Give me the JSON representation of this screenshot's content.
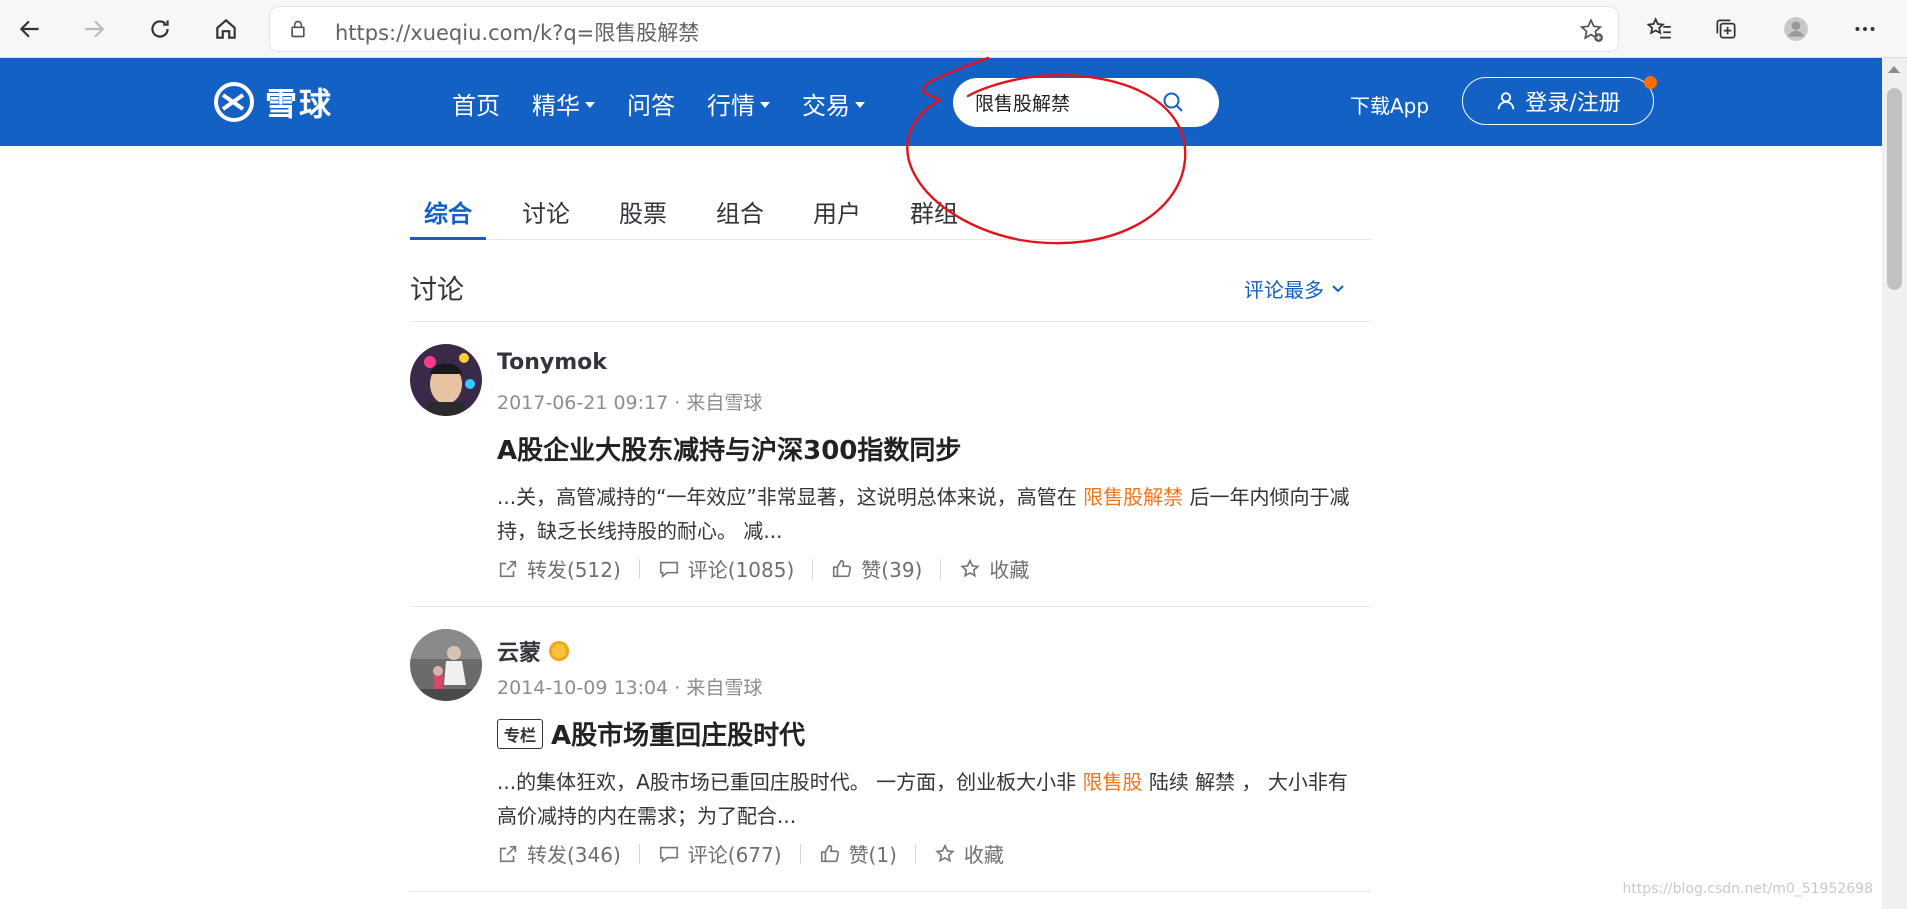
{
  "browser": {
    "url": "https://xueqiu.com/k?q=限售股解禁"
  },
  "site": {
    "logo_text": "雪球",
    "nav": [
      {
        "label": "首页",
        "has_menu": false
      },
      {
        "label": "精华",
        "has_menu": true
      },
      {
        "label": "问答",
        "has_menu": false
      },
      {
        "label": "行情",
        "has_menu": true
      },
      {
        "label": "交易",
        "has_menu": true
      }
    ],
    "search_value": "限售股解禁",
    "download_label": "下载App",
    "login_label": "登录/注册",
    "brand_color": "#1461c5",
    "highlight_color": "#f3751a"
  },
  "tabs": [
    "综合",
    "讨论",
    "股票",
    "组合",
    "用户",
    "群组"
  ],
  "active_tab": "综合",
  "section": {
    "title": "讨论",
    "sort_label": "评论最多"
  },
  "posts": [
    {
      "author": "Tonymok",
      "meta": "2017-06-21 09:17 · 来自雪球",
      "tag": "",
      "title": "A股企业大股东减持与沪深300指数同步",
      "excerpt_before": "...关，高管减持的“一年效应”非常显著，这说明总体来说，高管在 ",
      "excerpt_highlight": "限售股解禁",
      "excerpt_after": " 后一年内倾向于减持，缺乏长线持股的耐心。 减...",
      "repost": "转发(512)",
      "comment": "评论(1085)",
      "like": "赞(39)",
      "collect": "收藏"
    },
    {
      "author": "云蒙",
      "meta": "2014-10-09 13:04 · 来自雪球",
      "tag": "专栏",
      "title": "A股市场重回庄股时代",
      "excerpt_before": "...的集体狂欢，A股市场已重回庄股时代。 一方面，创业板大小非 ",
      "excerpt_highlight": "限售股",
      "excerpt_after": " 陆续 解禁 ， 大小非有高价减持的内在需求；为了配合...",
      "repost": "转发(346)",
      "comment": "评论(677)",
      "like": "赞(1)",
      "collect": "收藏"
    }
  ],
  "watermark": "https://blog.csdn.net/m0_51952698"
}
